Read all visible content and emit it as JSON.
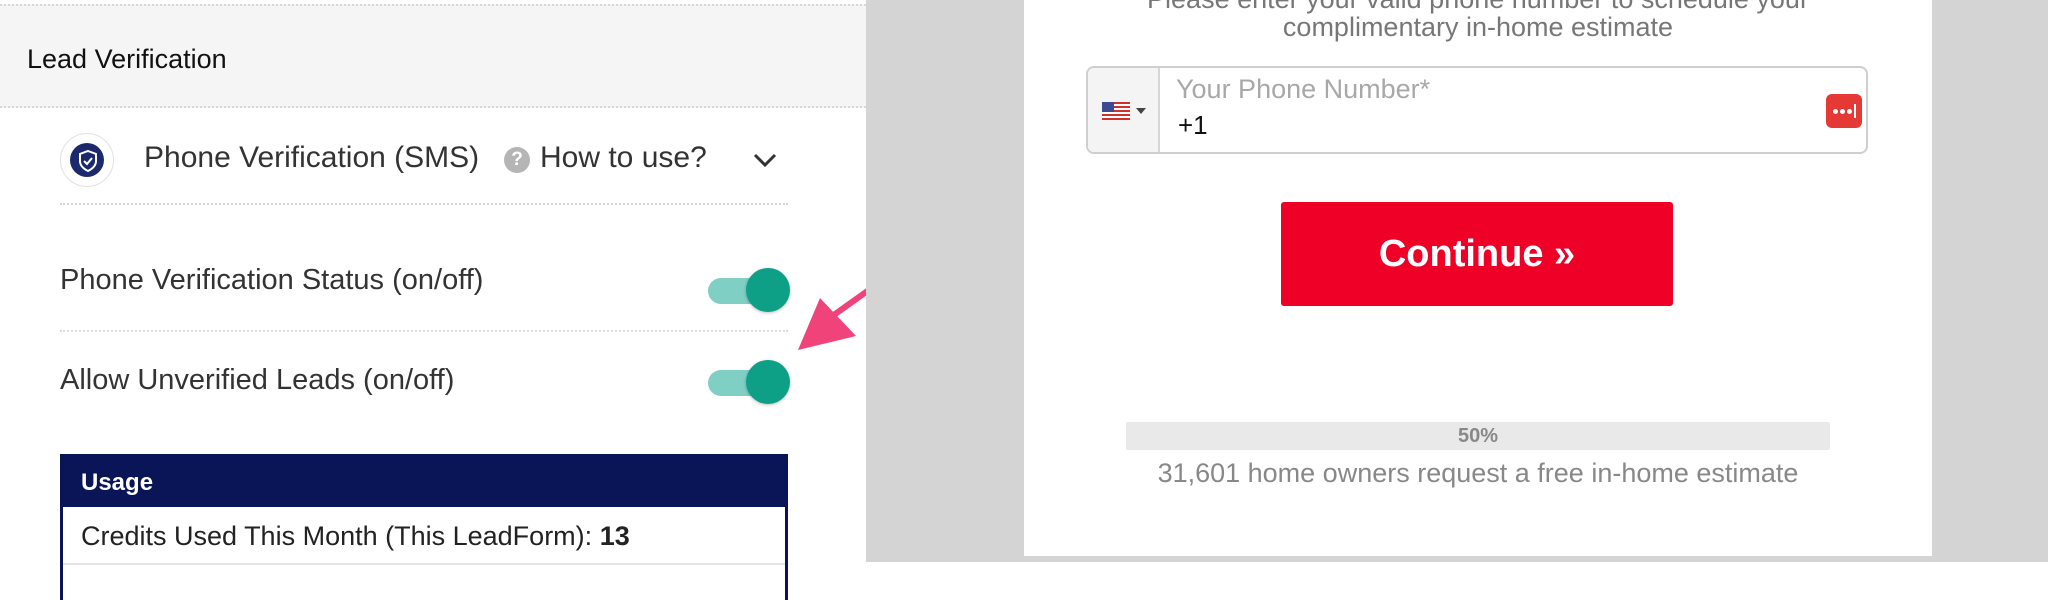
{
  "settings": {
    "section_title": "Lead Verification",
    "phone_verification_label": "Phone Verification (SMS)",
    "help_icon_glyph": "?",
    "how_to_use": "How to use?",
    "toggles": [
      {
        "label": "Phone Verification Status (on/off)",
        "state": "on"
      },
      {
        "label": "Allow Unverified Leads (on/off)",
        "state": "on"
      }
    ],
    "usage": {
      "title": "Usage",
      "credits_label": "Credits Used This Month (This LeadForm):",
      "credits_value": "13"
    },
    "colors": {
      "toggle_on": "#0e9f87",
      "usage_header": "#0a1557",
      "arrow": "#f0437a"
    }
  },
  "preview": {
    "intro_line1": "Please enter your valid phone number to schedule your",
    "intro_line2": "complimentary in-home estimate",
    "phone_placeholder": "Your Phone Number*",
    "phone_value": "+1",
    "country_flag": "us-flag-icon",
    "continue_label": "Continue »",
    "progress_label": "50%",
    "progress_value": 0.5,
    "social_proof": "31,601 home owners request a free in-home estimate",
    "colors": {
      "continue_button": "#ee0027"
    }
  }
}
